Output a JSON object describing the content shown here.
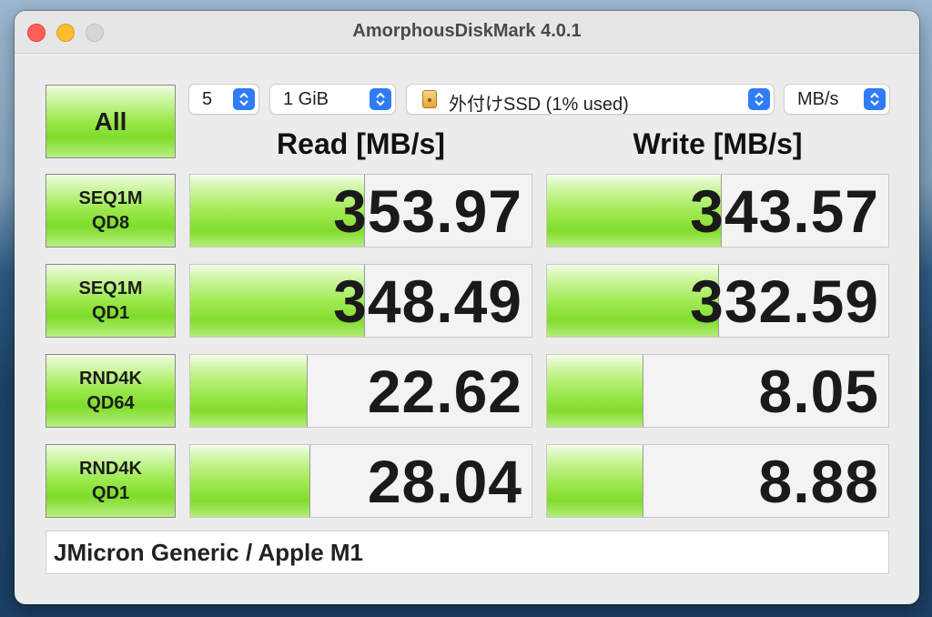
{
  "window": {
    "title": "AmorphousDiskMark 4.0.1"
  },
  "controls": {
    "all_label": "All",
    "count": "5",
    "size": "1 GiB",
    "drive": "外付けSSD (1% used)",
    "unit": "MB/s"
  },
  "headers": {
    "read": "Read [MB/s]",
    "write": "Write [MB/s]"
  },
  "tests": [
    {
      "line1": "SEQ1M",
      "line2": "QD8",
      "read": "353.97",
      "write": "343.57",
      "read_fill_pct": 51,
      "write_fill_pct": 51
    },
    {
      "line1": "SEQ1M",
      "line2": "QD1",
      "read": "348.49",
      "write": "332.59",
      "read_fill_pct": 51,
      "write_fill_pct": 50
    },
    {
      "line1": "RND4K",
      "line2": "QD64",
      "read": "22.62",
      "write": "8.05",
      "read_fill_pct": 34,
      "write_fill_pct": 28
    },
    {
      "line1": "RND4K",
      "line2": "QD1",
      "read": "28.04",
      "write": "8.88",
      "read_fill_pct": 35,
      "write_fill_pct": 28
    }
  ],
  "comment": "JMicron Generic / Apple M1",
  "colors": {
    "accent": "#2f7cf6",
    "bar_green": "#83dc2c"
  }
}
